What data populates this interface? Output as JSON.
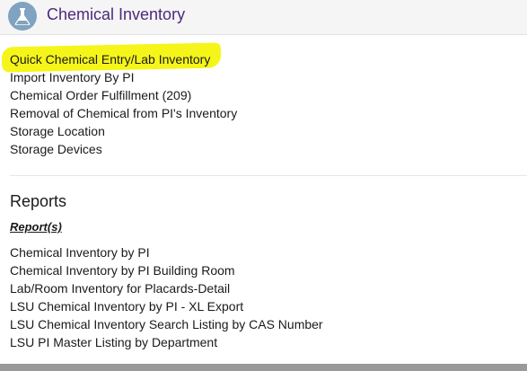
{
  "header": {
    "title": "Chemical Inventory",
    "icon": "flask-icon",
    "icon_color": "#7fa3c0",
    "title_color": "#4b2a7b"
  },
  "links": [
    {
      "label": "Quick Chemical Entry/Lab Inventory",
      "highlighted": true
    },
    {
      "label": "Import Inventory By PI"
    },
    {
      "label": "Chemical Order Fulfillment (209)"
    },
    {
      "label": "Removal of Chemical from PI's Inventory"
    },
    {
      "label": "Storage Location"
    },
    {
      "label": "Storage Devices"
    }
  ],
  "highlight_color": "#f5f51a",
  "reports": {
    "heading": "Reports",
    "subheading": "Report(s)",
    "items": [
      "Chemical Inventory by PI",
      "Chemical Inventory by PI Building Room",
      "Lab/Room Inventory for Placards-Detail",
      "LSU Chemical Inventory by PI - XL Export",
      "LSU Chemical Inventory Search Listing by CAS Number",
      "LSU PI Master Listing by Department"
    ]
  }
}
